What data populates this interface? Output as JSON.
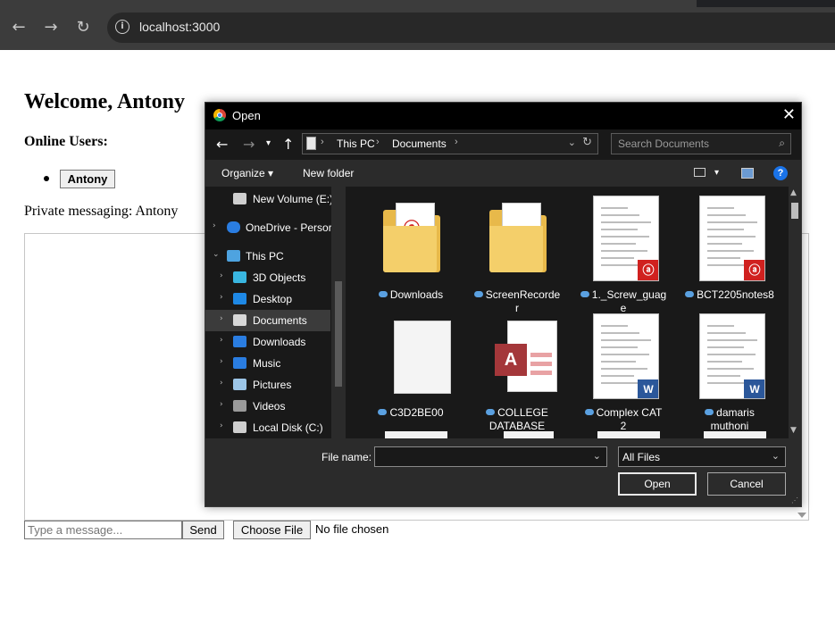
{
  "browser": {
    "url": "localhost:3000",
    "back_icon": "←",
    "forward_icon": "→",
    "reload_icon": "↻"
  },
  "page": {
    "title": "Welcome, Antony",
    "online_heading": "Online Users:",
    "users": [
      "Antony"
    ],
    "pm_label": "Private messaging: Antony",
    "message_placeholder": "Type a message...",
    "send_label": "Send",
    "choose_file_label": "Choose File",
    "no_file_text": "No file chosen"
  },
  "dialog": {
    "title": "Open",
    "close_icon": "✕",
    "breadcrumb": [
      "This PC",
      "Documents"
    ],
    "search_placeholder": "Search Documents",
    "toolbar": {
      "organize": "Organize ▾",
      "new_folder": "New folder",
      "help": "?"
    },
    "nav_items": [
      {
        "label": "New Volume (E:)",
        "icon": "drive-icon",
        "color": "#cfcfcf"
      },
      {
        "label": "OneDrive - Persor",
        "icon": "onedrive-icon",
        "color": "#2a7de1"
      },
      {
        "label": "This PC",
        "icon": "this-pc-icon",
        "color": "#4ea3e0"
      },
      {
        "label": "3D Objects",
        "icon": "3d-objects-icon",
        "color": "#39b6e0"
      },
      {
        "label": "Desktop",
        "icon": "desktop-icon",
        "color": "#1e88e5"
      },
      {
        "label": "Documents",
        "icon": "documents-icon",
        "color": "#d8d8d8"
      },
      {
        "label": "Downloads",
        "icon": "downloads-icon",
        "color": "#2a7de1"
      },
      {
        "label": "Music",
        "icon": "music-icon",
        "color": "#2a7de1"
      },
      {
        "label": "Pictures",
        "icon": "pictures-icon",
        "color": "#9cc6e8"
      },
      {
        "label": "Videos",
        "icon": "videos-icon",
        "color": "#9a9a9a"
      },
      {
        "label": "Local Disk (C:)",
        "icon": "local-disk-icon",
        "color": "#cfcfcf"
      }
    ],
    "selected_nav": "Documents",
    "files": [
      {
        "name": "Downloads",
        "line2": "",
        "kind": "folder-pdf"
      },
      {
        "name": "ScreenRecorde",
        "line2": "r",
        "kind": "folder-gear"
      },
      {
        "name": "1._Screw_guag",
        "line2": "e",
        "kind": "pdf"
      },
      {
        "name": "BCT2205notes8",
        "line2": "",
        "kind": "pdf"
      },
      {
        "name": "C3D2BE00",
        "line2": "",
        "kind": "blank"
      },
      {
        "name": "COLLEGE",
        "line2": "DATABASE",
        "kind": "access"
      },
      {
        "name": "Complex CAT",
        "line2": "2",
        "kind": "word"
      },
      {
        "name": "damaris",
        "line2": "muthoni",
        "kind": "word"
      }
    ],
    "file_name_label": "File name:",
    "file_name_value": "",
    "file_type": "All Files",
    "open_label": "Open",
    "cancel_label": "Cancel"
  }
}
